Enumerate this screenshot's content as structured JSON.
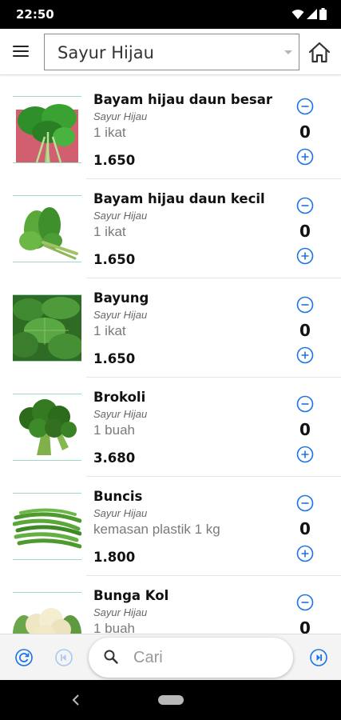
{
  "status": {
    "time": "22:50"
  },
  "header": {
    "category": "Sayur Hijau"
  },
  "products": [
    {
      "name": "Bayam hijau daun besar",
      "category": "Sayur Hijau",
      "unit": "1 ikat",
      "price": "1.650",
      "qty": "0",
      "image": "spinach-large-image"
    },
    {
      "name": "Bayam hijau daun kecil",
      "category": "Sayur Hijau",
      "unit": "1 ikat",
      "price": "1.650",
      "qty": "0",
      "image": "spinach-small-image"
    },
    {
      "name": "Bayung",
      "category": "Sayur Hijau",
      "unit": "1 ikat",
      "price": "1.650",
      "qty": "0",
      "image": "bayung-leaves-image"
    },
    {
      "name": "Brokoli",
      "category": "Sayur Hijau",
      "unit": "1 buah",
      "price": "3.680",
      "qty": "0",
      "image": "broccoli-image"
    },
    {
      "name": "Buncis",
      "category": "Sayur Hijau",
      "unit": "kemasan plastik 1 kg",
      "price": "1.800",
      "qty": "0",
      "image": "green-beans-image"
    },
    {
      "name": "Bunga Kol",
      "category": "Sayur Hijau",
      "unit": "1 buah",
      "price": "",
      "qty": "0",
      "image": "cauliflower-image"
    }
  ],
  "search": {
    "placeholder": "Cari"
  },
  "colors": {
    "accent": "#1a73e8",
    "thumb_border": "#9fd9c6"
  }
}
